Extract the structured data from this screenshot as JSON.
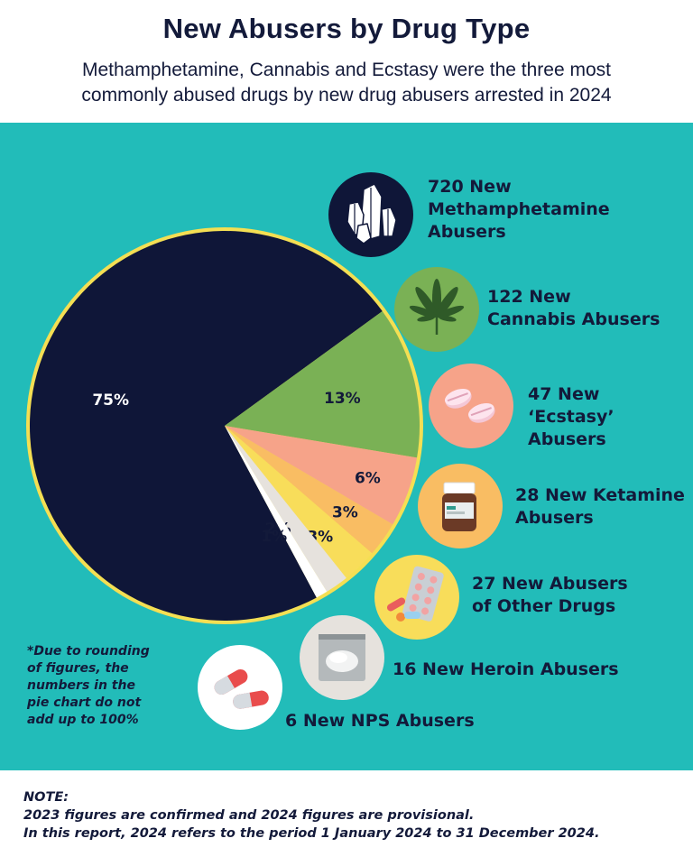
{
  "header": {
    "title": "New Abusers by Drug Type",
    "subtitle_line1": "Methamphetamine, Cannabis and Ecstasy were the three most",
    "subtitle_line2": "commonly abused drugs by new drug abusers arrested in 2024"
  },
  "chart_data": {
    "type": "pie",
    "title": "New Abusers by Drug Type",
    "slices": [
      {
        "name": "Methamphetamine",
        "value": 75,
        "label": "75%",
        "color": "#0f1638"
      },
      {
        "name": "Cannabis",
        "value": 13,
        "label": "13%",
        "color": "#7ab155"
      },
      {
        "name": "Ecstasy",
        "value": 6,
        "label": "6%",
        "color": "#f6a389"
      },
      {
        "name": "Ketamine",
        "value": 3,
        "label": "3%",
        "color": "#f9bd63"
      },
      {
        "name": "Other Drugs",
        "value": 3,
        "label": "3%",
        "color": "#f8dd5a"
      },
      {
        "name": "Heroin",
        "value": 2,
        "label": "2%",
        "color": "#e6e2dd"
      },
      {
        "name": "NPS",
        "value": 1,
        "label": "1%",
        "color": "#ffffff"
      }
    ],
    "border_color": "#f4df53"
  },
  "legend": {
    "meth": [
      "720 New",
      "Methamphetamine",
      "Abusers"
    ],
    "cannabis": [
      "122 New",
      "Cannabis Abusers"
    ],
    "ecstasy": [
      "47 New",
      "‘Ecstasy’",
      "Abusers"
    ],
    "ketamine": [
      "28 New Ketamine",
      "Abusers"
    ],
    "other": [
      "27 New Abusers",
      "of Other Drugs"
    ],
    "heroin": [
      "16 New Heroin Abusers"
    ],
    "nps": [
      "6 New NPS Abusers"
    ]
  },
  "icons": {
    "meth": "crystal-icon",
    "cannabis": "cannabis-leaf-icon",
    "ecstasy": "ecstasy-pill-icon",
    "ketamine": "medicine-bottle-icon",
    "other": "pill-blister-icon",
    "heroin": "powder-bag-icon",
    "nps": "capsule-icon"
  },
  "rounding_note": [
    "*Due to rounding",
    "of figures, the",
    "numbers in the",
    "pie chart do not",
    "add up to 100%"
  ],
  "footer": {
    "heading": "NOTE:",
    "line1": "2023 figures are confirmed and 2024 figures are provisional.",
    "line2": "In this report, 2024 refers to the period 1 January 2024 to 31 December 2024."
  },
  "colors": {
    "teal_background": "#22bcb9",
    "navy": "#131a3a"
  }
}
